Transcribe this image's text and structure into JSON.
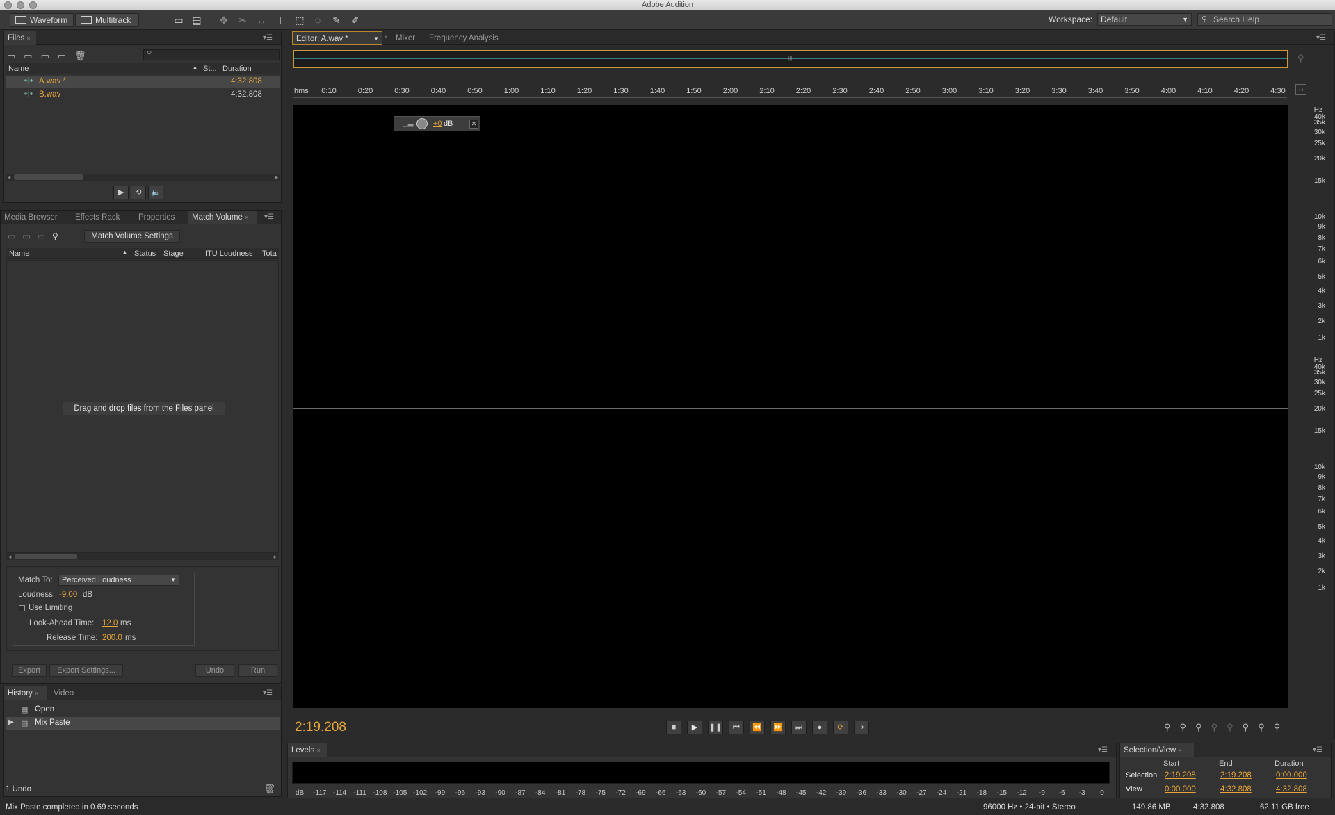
{
  "window": {
    "title": "Adobe Audition"
  },
  "toolbar": {
    "waveform_label": "Waveform",
    "multitrack_label": "Multitrack",
    "workspace_label": "Workspace:",
    "workspace_value": "Default",
    "search_placeholder": "Search Help"
  },
  "files_panel": {
    "tab": "Files",
    "columns": {
      "name": "Name",
      "status": "St...",
      "duration": "Duration"
    },
    "rows": [
      {
        "name": "A.wav *",
        "duration": "4:32.808"
      },
      {
        "name": "B.wav",
        "duration": "4:32.808"
      }
    ]
  },
  "mid_panel": {
    "tabs": [
      "Media Browser",
      "Effects Rack",
      "Properties",
      "Match Volume"
    ],
    "match_settings_button": "Match Volume Settings",
    "columns": {
      "name": "Name",
      "status": "Status",
      "stage": "Stage",
      "itu": "ITU Loudness",
      "total": "Tota"
    },
    "empty_hint": "Drag and drop files from the Files panel",
    "match_to_label": "Match To:",
    "match_to_value": "Perceived Loudness",
    "loudness_label": "Loudness:",
    "loudness_value": "-9.00",
    "loudness_unit": "dB",
    "use_limiting_label": "Use Limiting",
    "lookahead_label": "Look-Ahead Time:",
    "lookahead_value": "12.0",
    "lookahead_unit": "ms",
    "release_label": "Release Time:",
    "release_value": "200.0",
    "release_unit": "ms",
    "export_button": "Export",
    "export_settings_button": "Export Settings...",
    "undo_button": "Undo",
    "run_button": "Run"
  },
  "history_panel": {
    "tabs": [
      "History",
      "Video"
    ],
    "items": [
      "Open",
      "Mix Paste"
    ],
    "undo_count": "1 Undo"
  },
  "editor": {
    "tabs": [
      "Editor: A.wav *",
      "Mixer",
      "Frequency Analysis"
    ],
    "ruler_unit": "hms",
    "ruler_ticks": [
      "0:10",
      "0:20",
      "0:30",
      "0:40",
      "0:50",
      "1:00",
      "1:10",
      "1:20",
      "1:30",
      "1:40",
      "1:50",
      "2:00",
      "2:10",
      "2:20",
      "2:30",
      "2:40",
      "2:50",
      "3:00",
      "3:10",
      "3:20",
      "3:30",
      "3:40",
      "3:50",
      "4:00",
      "4:10",
      "4:20",
      "4:30"
    ],
    "hud_gain": "+0",
    "hud_unit": "dB",
    "hz_unit": "Hz",
    "hz_labels": [
      "40k",
      "35k",
      "30k",
      "25k",
      "20k",
      "15k",
      "10k",
      "9k",
      "8k",
      "7k",
      "6k",
      "5k",
      "4k",
      "3k",
      "2k",
      "1k"
    ],
    "current_time": "2:19.208",
    "playhead_fraction": 0.513,
    "accent_color": "#e6a53a"
  },
  "levels_panel": {
    "tab": "Levels",
    "scale": [
      "dB",
      "-117",
      "-114",
      "-111",
      "-108",
      "-105",
      "-102",
      "-99",
      "-96",
      "-93",
      "-90",
      "-87",
      "-84",
      "-81",
      "-78",
      "-75",
      "-72",
      "-69",
      "-66",
      "-63",
      "-60",
      "-57",
      "-54",
      "-51",
      "-48",
      "-45",
      "-42",
      "-39",
      "-36",
      "-33",
      "-30",
      "-27",
      "-24",
      "-21",
      "-18",
      "-15",
      "-12",
      "-9",
      "-6",
      "-3",
      "0"
    ]
  },
  "selection_view": {
    "tab": "Selection/View",
    "headers": {
      "start": "Start",
      "end": "End",
      "duration": "Duration"
    },
    "selection_label": "Selection",
    "selection": {
      "start": "2:19.208",
      "end": "2:19.208",
      "duration": "0:00.000"
    },
    "view_label": "View",
    "view": {
      "start": "0:00.000",
      "end": "4:32.808",
      "duration": "4:32.808"
    }
  },
  "status_bar": {
    "message": "Mix Paste completed in 0.69 seconds",
    "format": "96000 Hz • 24-bit • Stereo",
    "size": "149.86 MB",
    "duration": "4:32.808",
    "free": "62.11 GB free"
  }
}
